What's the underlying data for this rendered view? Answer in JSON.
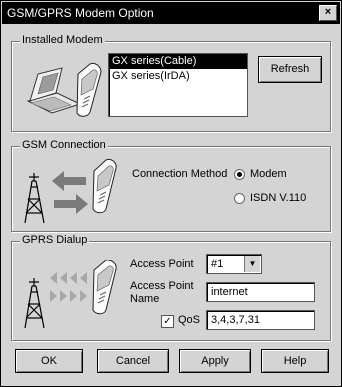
{
  "window": {
    "title": "GSM/GPRS Modem Option",
    "close_label": "×"
  },
  "installed_modem": {
    "label": "Installed Modem",
    "items": [
      {
        "label": "GX series(Cable)",
        "selected": true
      },
      {
        "label": "GX series(IrDA)",
        "selected": false
      }
    ],
    "refresh_label": "Refresh"
  },
  "gsm_connection": {
    "label": "GSM Connection",
    "method_label": "Connection Method",
    "options": [
      {
        "label": "Modem",
        "checked": true
      },
      {
        "label": "ISDN V.110",
        "checked": false
      }
    ]
  },
  "gprs_dialup": {
    "label": "GPRS Dialup",
    "access_point_label": "Access Point",
    "access_point_value": "#1",
    "access_point_name_label": "Access Point\nName",
    "access_point_name_line1": "Access Point",
    "access_point_name_line2": "Name",
    "access_point_name_value": "internet",
    "qos_label": "QoS",
    "qos_checked": true,
    "qos_value": "3,4,3,7,31"
  },
  "buttons": {
    "ok": "OK",
    "cancel": "Cancel",
    "apply": "Apply",
    "help": "Help"
  },
  "icons": [
    "laptop-icon",
    "phone-icon",
    "antenna-tower-icon",
    "arrows-icon",
    "down-arrow-icon",
    "check-icon"
  ]
}
